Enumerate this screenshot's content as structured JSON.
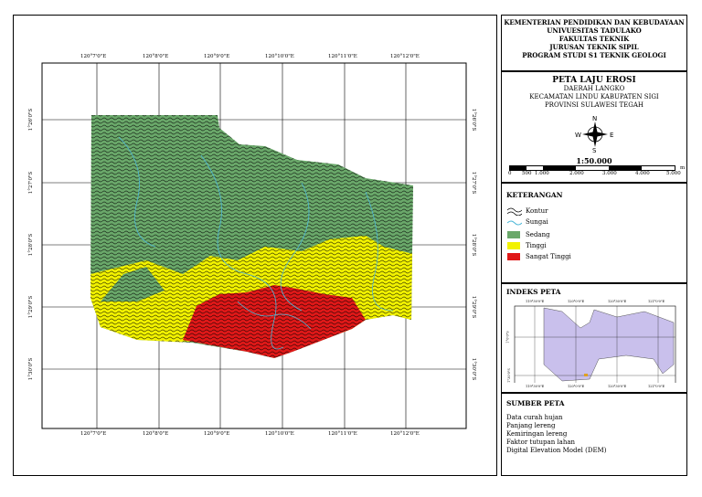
{
  "institution": {
    "line1": "KEMENTERIAN PENDIDIKAN DAN KEBUDAYAAN",
    "line2": "UNIVUESITAS TADULAKO",
    "line3": "FAKULTAS TEKNIK",
    "line4": "JURUSAN TEKNIK SIPIL",
    "line5": "PROGRAM STUDI S1 TEKNIK GEOLOGI"
  },
  "title": {
    "main": "PETA LAJU EROSI",
    "sub1": "DAERAH LANGKO",
    "sub2": "KECAMATAN LINDU KABUPATEN SIGI",
    "sub3": "PROVINSI SULAWESI TEGAH"
  },
  "north_arrow": {
    "n": "N",
    "s": "S",
    "e": "E",
    "w": "W"
  },
  "scale": {
    "ratio": "1:50.000",
    "ticks": [
      "0",
      "500",
      "1.000",
      "2.000",
      "3.000",
      "4.000",
      "5.000"
    ],
    "unit": "m"
  },
  "legend": {
    "heading": "KETERANGAN",
    "items": [
      {
        "label": "Kontur",
        "type": "line",
        "color": "#000000"
      },
      {
        "label": "Sungai",
        "type": "line",
        "color": "#4fb8d8"
      },
      {
        "label": "Sedang",
        "type": "fill",
        "color": "#6aa86a"
      },
      {
        "label": "Tinggi",
        "type": "fill",
        "color": "#f2f200"
      },
      {
        "label": "Sangat Tinggi",
        "type": "fill",
        "color": "#e01818"
      }
    ]
  },
  "index_map": {
    "heading": "INDEKS PETA",
    "top_labels": [
      "119°30'0\"E",
      "120°0'0\"E",
      "120°30'0\"E",
      "121°0'0\"E"
    ],
    "bottom_labels": [
      "119°30'0\"E",
      "120°0'0\"E",
      "120°30'0\"E",
      "121°0'0\"E"
    ],
    "side_labels": [
      "1°0'0\"S",
      "1°30'0\"S"
    ],
    "land_color": "#c9c0ec"
  },
  "sources": {
    "heading": "SUMBER PETA",
    "items": [
      "Data curah hujan",
      "Panjang lereng",
      "Kemiringan lereng",
      "Faktor tutupan lahan",
      "Digital Elevation Model (DEM)"
    ]
  },
  "map": {
    "lon_labels": [
      "120°7'0\"E",
      "120°8'0\"E",
      "120°9'0\"E",
      "120°10'0\"E",
      "120°11'0\"E",
      "120°12'0\"E"
    ],
    "lat_labels": [
      "1°26'0\"S",
      "1°27'0\"S",
      "1°28'0\"S",
      "1°29'0\"S",
      "1°30'0\"S"
    ],
    "colors": {
      "sedang": "#6aa86a",
      "tinggi": "#f2f200",
      "sangat_tinggi": "#e01818",
      "river": "#4fb8d8"
    }
  }
}
